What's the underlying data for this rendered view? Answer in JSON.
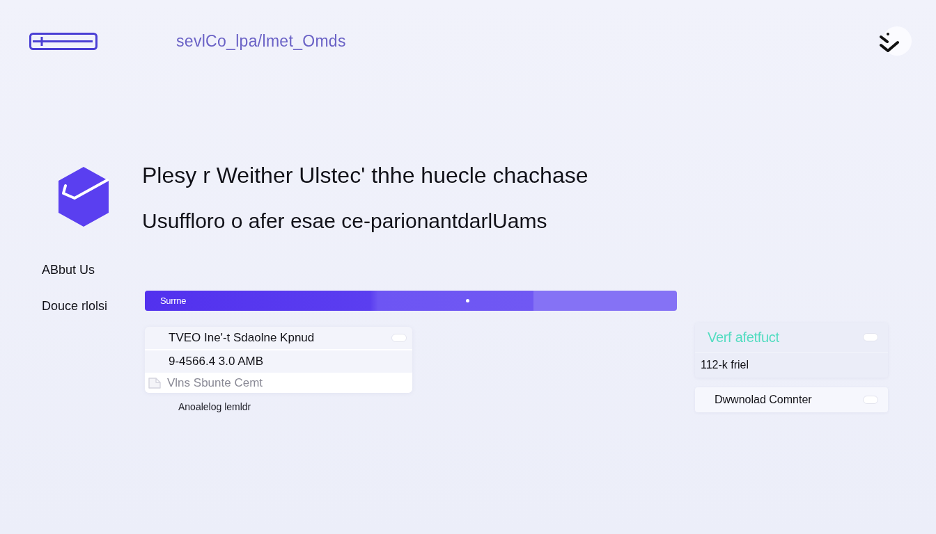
{
  "header": {
    "path": "sevlCo_lpa/lmet_Omds"
  },
  "hero": {
    "title": "Plesy r Weither Ulstec' thhe huecle chachase",
    "subtitle": "Usuffloro o afer esae ce-parionantdarlUams"
  },
  "sidebar": {
    "items": [
      {
        "label": "ABbut Us"
      },
      {
        "label": "Douce rlolsi"
      }
    ]
  },
  "progress": {
    "label": "Surrne",
    "level": 0.73
  },
  "list": {
    "rows": [
      {
        "kind": "action",
        "text": "TVEO Ine'-t Sdaolne Kpnud"
      },
      {
        "kind": "text",
        "text": "9-4566.4 3.0 AMB"
      },
      {
        "kind": "file",
        "text": "Vlns Sbunte Cemt"
      }
    ],
    "caption": "Anoalelog lemldr"
  },
  "status_card": {
    "title": "Verf afetfuct",
    "value": "112-k friel"
  },
  "download_button": {
    "label": "Dwwnolad Comnter"
  }
}
